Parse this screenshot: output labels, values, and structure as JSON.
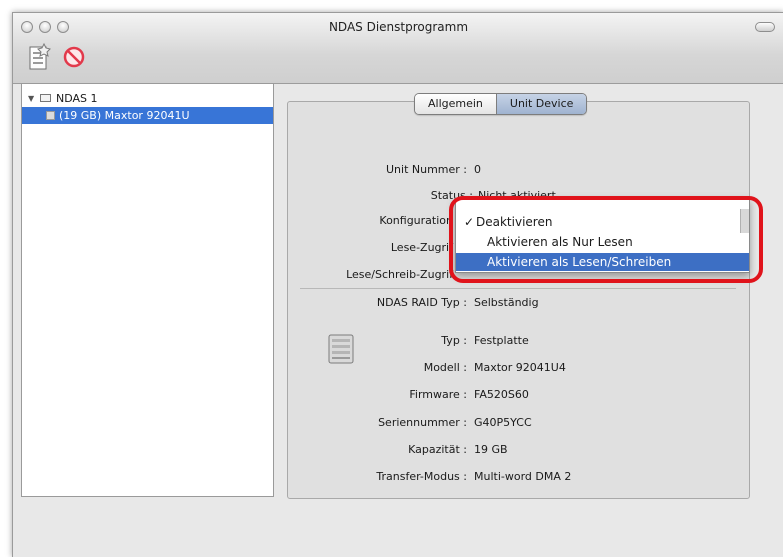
{
  "window": {
    "title": "NDAS Dienstprogramm"
  },
  "toolbar": {
    "add_icon": "new-device-icon",
    "remove_icon": "prohibited-icon"
  },
  "sidebar": {
    "root_label": "NDAS 1",
    "child_label": "(19 GB) Maxtor 92041U"
  },
  "tabs": {
    "general": "Allgemein",
    "unit_device": "Unit Device",
    "active": "Unit Device"
  },
  "unit": {
    "unit_number_label": "Unit Nummer :",
    "unit_number_value": "0",
    "status_label": "Status :",
    "status_value": "Nicht aktiviert",
    "config_label": "Konfiguration",
    "read_access_label": "Lese-Zugrif",
    "rw_access_label": "Lese/Schreib-Zugrif",
    "raid_label": "NDAS RAID Typ :",
    "raid_value": "Selbständig"
  },
  "popup": {
    "options": [
      "Deaktivieren",
      "Aktivieren als Nur Lesen",
      "Aktivieren als Lesen/Schreiben"
    ],
    "checked": "✓",
    "checked_index": 0,
    "selected_index": 2
  },
  "device": {
    "icon": "hard-drive-icon",
    "type_label": "Typ :",
    "type_value": "Festplatte",
    "model_label": "Modell :",
    "model_value": "Maxtor 92041U4",
    "firmware_label": "Firmware :",
    "firmware_value": "FA520S60",
    "serial_label": "Seriennummer :",
    "serial_value": "G40P5YCC",
    "capacity_label": "Kapazität :",
    "capacity_value": "19 GB",
    "transfer_label": "Transfer-Modus :",
    "transfer_value": "Multi-word DMA 2"
  },
  "colors": {
    "selection": "#3875d7",
    "highlight_ring": "#e0131b"
  }
}
